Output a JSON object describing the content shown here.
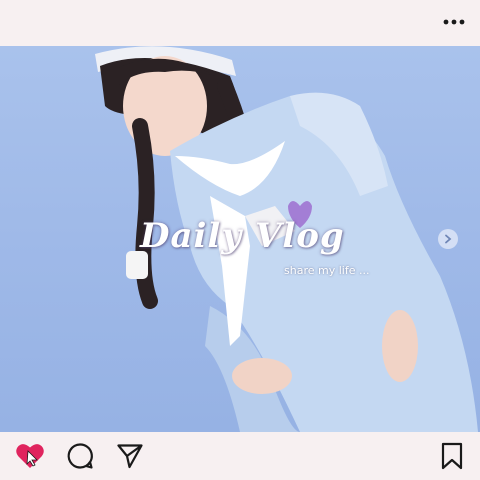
{
  "post": {
    "overlay_title": "Daily Vlog",
    "overlay_subtitle": "share my life ..."
  },
  "icons": {
    "more": "more-horizontal-icon",
    "next": "chevron-right-icon",
    "like": "heart-icon",
    "comment": "comment-icon",
    "share": "send-icon",
    "save": "bookmark-icon"
  },
  "colors": {
    "background": "#f7f0f1",
    "like_active": "#e0245e",
    "icon": "#1a1a1a",
    "sky": "#a9c2ec"
  }
}
